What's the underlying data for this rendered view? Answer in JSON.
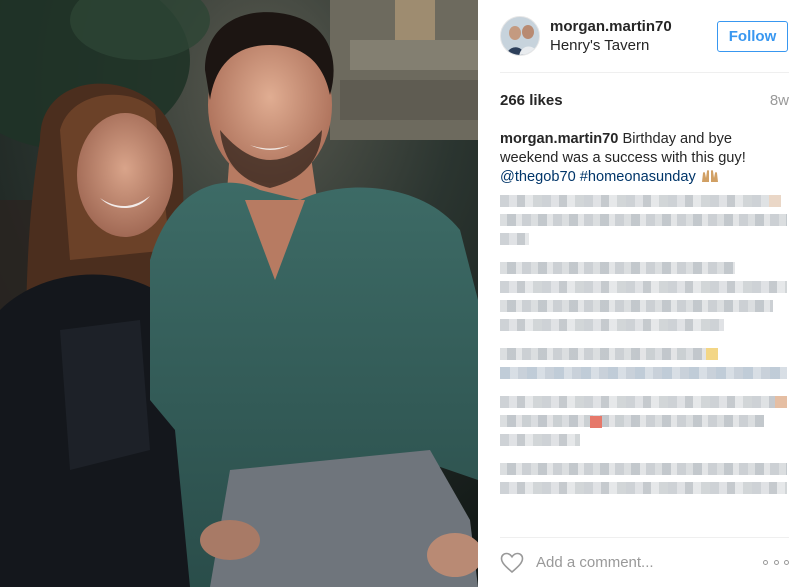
{
  "post": {
    "username": "morgan.martin70",
    "location": "Henry's Tavern",
    "follow_label": "Follow",
    "likes": "266 likes",
    "time_ago": "8w"
  },
  "caption": {
    "author": "morgan.martin70",
    "text": "Birthday and bye weekend was a success with this guy!",
    "mention": "@thegob70",
    "hashtag": "#homeonasunday"
  },
  "comment_box": {
    "placeholder": "Add a comment..."
  },
  "colors": {
    "accent": "#3897f0",
    "link": "#003569",
    "muted": "#999999",
    "text": "#262626"
  },
  "icons": {
    "like": "heart-icon",
    "more": "more-options-icon",
    "caption_emoji": "raised-hands-emoji-icon"
  }
}
